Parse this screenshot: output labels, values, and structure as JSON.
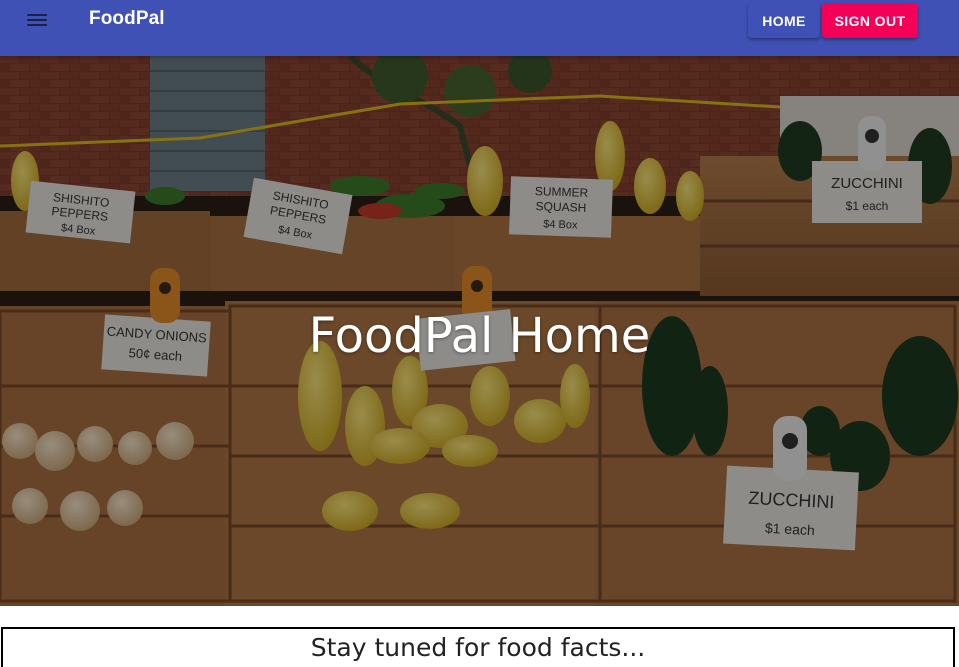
{
  "appbar": {
    "menu_icon": "menu-icon",
    "brand": "FoodPal",
    "home_label": "HOME",
    "signout_label": "SIGN OUT",
    "bar_color": "#3f51b5",
    "signout_color": "#f50057"
  },
  "hero": {
    "title": "FoodPal Home",
    "image_subject": "farmers market crates of squash, peppers, onions and zucchini",
    "signs": [
      {
        "line1": "SHISHITO",
        "line2": "PEPPERS",
        "price": "$4 Box"
      },
      {
        "line1": "SHISHITO",
        "line2": "PEPPERS",
        "price": "$4 Box"
      },
      {
        "line1": "SUMMER",
        "line2": "SQUASH",
        "price": "$4 Box"
      },
      {
        "line1": "ZUCCHINI",
        "line2": "",
        "price": "$1 each"
      },
      {
        "line1": "CANDY ONIONS",
        "line2": "",
        "price": "50¢ each"
      },
      {
        "line1": "ZUCCHINI",
        "line2": "",
        "price": "$1 each"
      }
    ]
  },
  "facts": {
    "text": "Stay tuned for food facts..."
  }
}
